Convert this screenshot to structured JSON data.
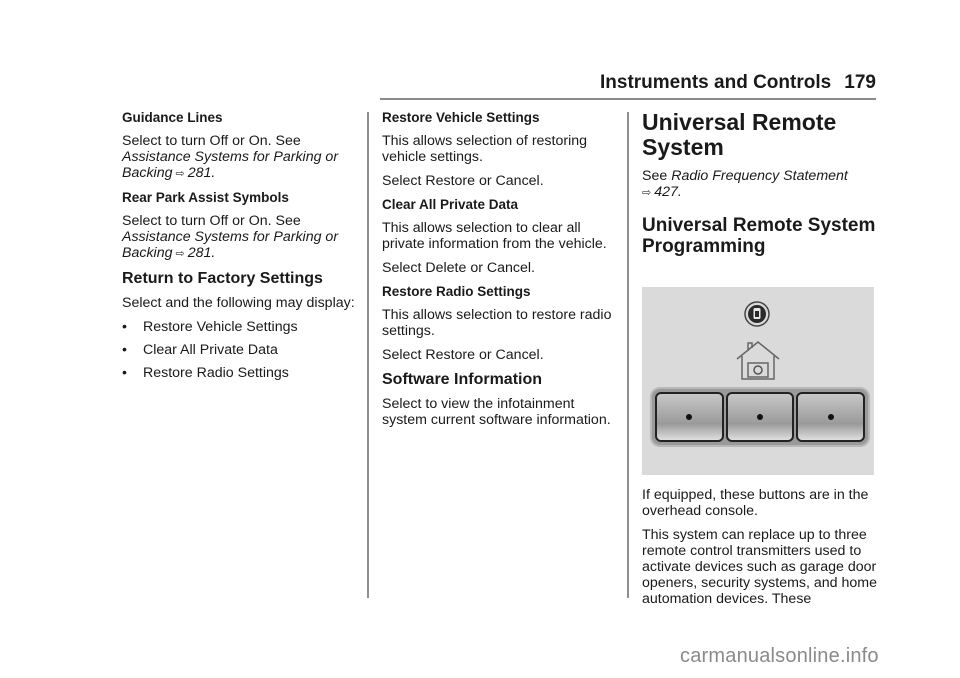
{
  "header": {
    "title": "Instruments and Controls",
    "page_number": "179"
  },
  "column1": {
    "guidance_lines": {
      "heading": "Guidance Lines",
      "text": "Select to turn Off or On. See",
      "ref_italic": "Assistance Systems for Parking or Backing",
      "arrow": "⇨",
      "ref_page": "281."
    },
    "rear_park": {
      "heading": "Rear Park Assist Symbols",
      "text": "Select to turn Off or On. See",
      "ref_italic": "Assistance Systems for Parking or Backing",
      "arrow": "⇨",
      "ref_page": "281."
    },
    "factory": {
      "heading": "Return to Factory Settings",
      "text": "Select and the following may display:",
      "bullet": "•",
      "items": [
        "Restore Vehicle Settings",
        "Clear All Private Data",
        "Restore Radio Settings"
      ]
    }
  },
  "column2": {
    "restore_vehicle": {
      "heading": "Restore Vehicle Settings",
      "text": "This allows selection of restoring vehicle settings.",
      "action": "Select Restore or Cancel."
    },
    "clear_private": {
      "heading": "Clear All Private Data",
      "text": "This allows selection to clear all private information from the vehicle.",
      "action": "Select Delete or Cancel."
    },
    "restore_radio": {
      "heading": "Restore Radio Settings",
      "text": "This allows selection to restore radio settings.",
      "action": "Select Restore or Cancel."
    },
    "software": {
      "heading": "Software Information",
      "text": "Select to view the infotainment system current software information."
    }
  },
  "column3": {
    "title": "Universal Remote System",
    "see_label": "See",
    "see_ref_italic": "Radio Frequency Statement",
    "see_arrow": "⇨",
    "see_page": "427.",
    "subtitle": "Universal Remote System Programming",
    "figure": {
      "icons": [
        "lock-indicator-icon",
        "garage-home-icon"
      ],
      "button_count": 3
    },
    "para1": "If equipped, these buttons are in the overhead console.",
    "para2": "This system can replace up to three remote control transmitters used to activate devices such as garage door openers, security systems, and home automation devices. These"
  },
  "watermark": "carmanualsonline.info"
}
